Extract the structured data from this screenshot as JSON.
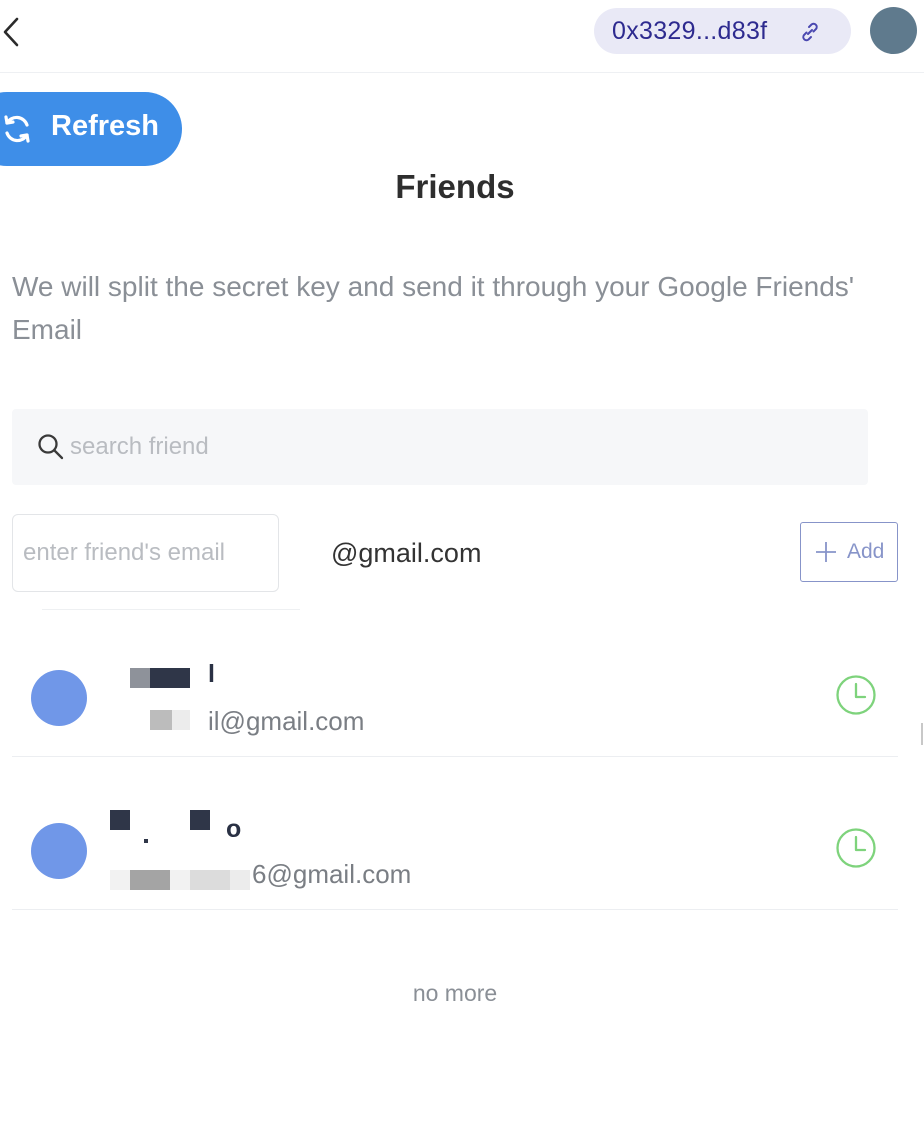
{
  "header": {
    "back_icon": "chevron-left-icon",
    "wallet_address": "0x3329...d83f",
    "link_icon": "link-icon",
    "avatar_color": "#5f7a8d"
  },
  "refresh_button": {
    "label": "Refresh",
    "icon": "refresh-icon",
    "color": "#3e8ee8"
  },
  "page": {
    "title": "Friends",
    "description": "We will split the secret key and send it through your Google Friends' Email"
  },
  "search": {
    "placeholder": "search friend",
    "icon": "search-icon"
  },
  "add_friend": {
    "email_placeholder": "enter friend's email",
    "domain_suffix": "@gmail.com",
    "add_label": "Add"
  },
  "friends": [
    {
      "name_visible": "l",
      "email_visible": "il@gmail.com",
      "status_icon": "clock-icon"
    },
    {
      "name_visible": "o",
      "email_visible": "6@gmail.com",
      "status_icon": "clock-icon"
    }
  ],
  "footer": {
    "no_more": "no more"
  },
  "colors": {
    "accent": "#3e8ee8",
    "address_text": "#2d2a8f",
    "status_pending": "#7ed37c",
    "avatar": "#7097e8"
  }
}
